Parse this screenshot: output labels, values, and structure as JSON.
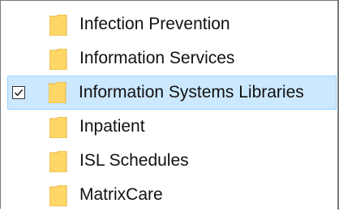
{
  "folder_tree": {
    "items": [
      {
        "label": "Infection Prevention",
        "checked": false,
        "selected": false
      },
      {
        "label": "Information Services",
        "checked": false,
        "selected": false
      },
      {
        "label": "Information Systems Libraries",
        "checked": true,
        "selected": true
      },
      {
        "label": "Inpatient",
        "checked": false,
        "selected": false
      },
      {
        "label": "ISL Schedules",
        "checked": false,
        "selected": false
      },
      {
        "label": "MatrixCare",
        "checked": false,
        "selected": false
      }
    ],
    "icon": "folder-icon"
  },
  "colors": {
    "selection_fill": "#cce8ff",
    "selection_border": "#99d1ff",
    "folder_fill": "#ffd767",
    "folder_edge": "#e0b340"
  }
}
